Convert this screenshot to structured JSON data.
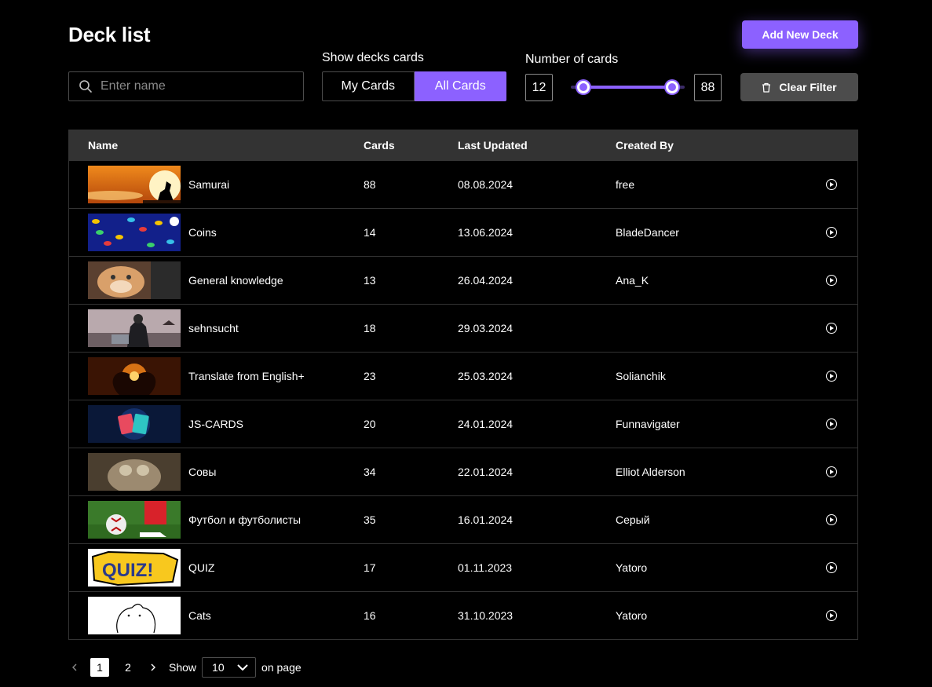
{
  "header": {
    "title": "Deck list",
    "add_button": "Add New Deck"
  },
  "filters": {
    "search_placeholder": "Enter name",
    "search_value": "",
    "show_label": "Show decks cards",
    "toggle": {
      "my": "My Cards",
      "all": "All Cards",
      "selected": "All Cards"
    },
    "range_label": "Number of cards",
    "range_min": "12",
    "range_max": "88",
    "range_bounds": [
      12,
      88
    ],
    "range_values": [
      12,
      88
    ],
    "clear_button": "Clear Filter"
  },
  "table": {
    "columns": [
      "Name",
      "Cards",
      "Last Updated",
      "Created By"
    ],
    "rows": [
      {
        "name": "Samurai",
        "cards": "88",
        "updated": "08.08.2024",
        "created_by": "free"
      },
      {
        "name": "Coins",
        "cards": "14",
        "updated": "13.06.2024",
        "created_by": "BladeDancer"
      },
      {
        "name": "General knowledge",
        "cards": "13",
        "updated": "26.04.2024",
        "created_by": "Ana_K"
      },
      {
        "name": "sehnsucht",
        "cards": "18",
        "updated": "29.03.2024",
        "created_by": ""
      },
      {
        "name": "Translate from English+",
        "cards": "23",
        "updated": "25.03.2024",
        "created_by": "Solianchik"
      },
      {
        "name": "JS-CARDS",
        "cards": "20",
        "updated": "24.01.2024",
        "created_by": "Funnavigater"
      },
      {
        "name": "Совы",
        "cards": "34",
        "updated": "22.01.2024",
        "created_by": "Elliot Alderson"
      },
      {
        "name": "Футбол и футболисты",
        "cards": "35",
        "updated": "16.01.2024",
        "created_by": "Серый"
      },
      {
        "name": "QUIZ",
        "cards": "17",
        "updated": "01.11.2023",
        "created_by": "Yatoro"
      },
      {
        "name": "Cats",
        "cards": "16",
        "updated": "31.10.2023",
        "created_by": "Yatoro"
      }
    ]
  },
  "pagination": {
    "pages": [
      "1",
      "2"
    ],
    "current": "1",
    "show_label": "Show",
    "per_page": "10",
    "on_page_label": "on page"
  },
  "colors": {
    "accent": "#8c61ff",
    "header_bg": "#333333",
    "border": "#333333"
  }
}
